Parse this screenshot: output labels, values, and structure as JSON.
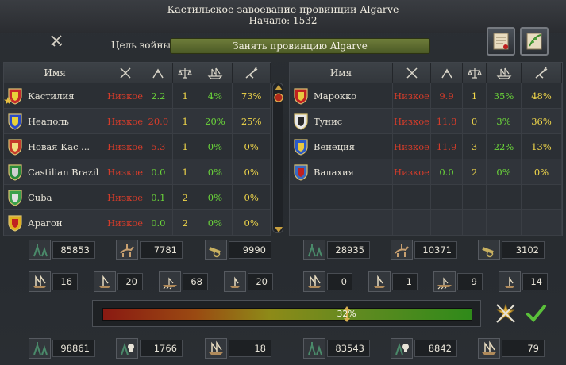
{
  "title": {
    "line1": "Кастильское завоевание провинции Algarve",
    "line2": "Начало: 1532"
  },
  "wargoal": {
    "label": "Цель войны",
    "value": "Занять провинцию Algarve"
  },
  "columns": {
    "name": "Имя"
  },
  "attackers": [
    {
      "name": "Кастилия",
      "status": "Низкое",
      "c1": "2.2",
      "c1_color": "green",
      "c2": "1",
      "c3": "4%",
      "c4": "73%",
      "shield": [
        "#c62a2a",
        "#e8d23a"
      ],
      "leader": true
    },
    {
      "name": "Неаполь",
      "status": "Низкое",
      "c1": "20.0",
      "c1_color": "red",
      "c2": "1",
      "c3": "20%",
      "c4": "25%",
      "shield": [
        "#2a4ac6",
        "#e8d23a"
      ]
    },
    {
      "name": "Новая Кас ...",
      "status": "Низкое",
      "c1": "5.3",
      "c1_color": "red",
      "c2": "1",
      "c3": "0%",
      "c4": "0%",
      "shield": [
        "#c63a2a",
        "#f0e080"
      ]
    },
    {
      "name": "Castilian Brazil",
      "status": "Низкое",
      "c1": "0.0",
      "c1_color": "green",
      "c2": "1",
      "c3": "0%",
      "c4": "0%",
      "shield": [
        "#2a8a3a",
        "#d0d0d0"
      ]
    },
    {
      "name": "Cuba",
      "status": "Низкое",
      "c1": "0.1",
      "c1_color": "green",
      "c2": "2",
      "c3": "0%",
      "c4": "0%",
      "shield": [
        "#3aa04a",
        "#e0e0e0"
      ]
    },
    {
      "name": "Арагон",
      "status": "Низкое",
      "c1": "0.0",
      "c1_color": "green",
      "c2": "2",
      "c3": "0%",
      "c4": "0%",
      "shield": [
        "#e0b020",
        "#c02020"
      ]
    }
  ],
  "defenders": [
    {
      "name": "Марокко",
      "status": "Низкое",
      "c1": "9.9",
      "c1_color": "red",
      "c2": "1",
      "c3": "35%",
      "c4": "48%",
      "shield": [
        "#c02020",
        "#e8c840"
      ],
      "leader": false
    },
    {
      "name": "Тунис",
      "status": "Низкое",
      "c1": "11.8",
      "c1_color": "red",
      "c2": "0",
      "c3": "3%",
      "c4": "36%",
      "shield": [
        "#e8e8e8",
        "#2a2a2a"
      ]
    },
    {
      "name": "Венеция",
      "status": "Низкое",
      "c1": "11.9",
      "c1_color": "red",
      "c2": "3",
      "c3": "22%",
      "c4": "13%",
      "shield": [
        "#2a5ac8",
        "#e8c840"
      ]
    },
    {
      "name": "Валахия",
      "status": "Низкое",
      "c1": "0.0",
      "c1_color": "green",
      "c2": "2",
      "c3": "0%",
      "c4": "0%",
      "shield": [
        "#3a6ac0",
        "#c02020"
      ]
    }
  ],
  "attacker_stats": {
    "infantry": "85853",
    "cavalry": "7781",
    "artillery": "9990",
    "heavy_ships": "16",
    "light_ships": "20",
    "galleys": "68",
    "transports": "20"
  },
  "defender_stats": {
    "infantry": "28935",
    "cavalry": "10371",
    "artillery": "3102",
    "heavy_ships": "0",
    "light_ships": "1",
    "galleys": "9",
    "transports": "14"
  },
  "warscore": {
    "label": "32%",
    "value": 0.32
  },
  "losses_attacker": {
    "army": "98861",
    "army_attrition": "1766",
    "ships": "18"
  },
  "losses_defender": {
    "army": "83543",
    "army_attrition": "8842",
    "ships": "79"
  },
  "colors": {
    "low_status": "#d63c2a",
    "good": "#6bd63a",
    "bad": "#d63c2a",
    "wargoal_bg": "#5f6e30"
  }
}
